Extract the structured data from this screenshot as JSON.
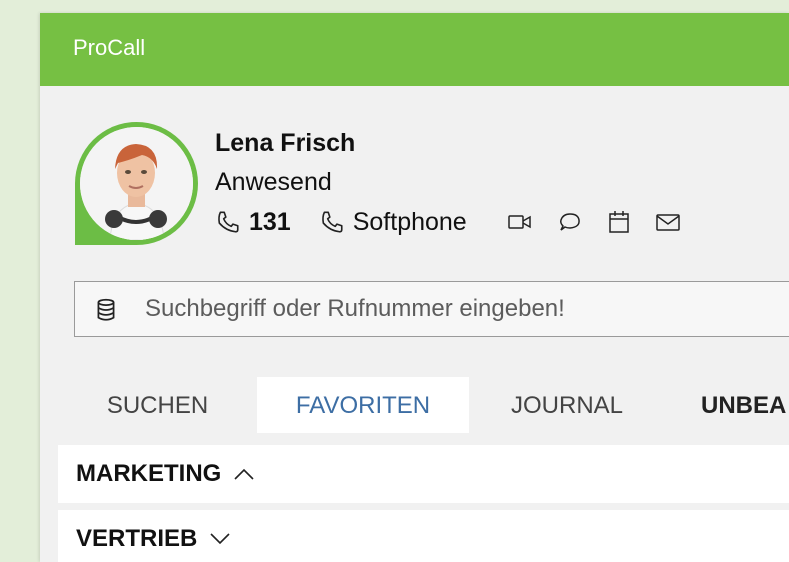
{
  "app": {
    "title": "ProCall"
  },
  "user": {
    "name": "Lena Frisch",
    "status": "Anwesend",
    "extension": "131",
    "device": "Softphone",
    "actions": [
      "video-icon",
      "chat-icon",
      "calendar-icon",
      "mail-icon"
    ]
  },
  "search": {
    "placeholder": "Suchbegriff oder Rufnummer eingeben!"
  },
  "tabs": [
    {
      "label": "SUCHEN",
      "active": false
    },
    {
      "label": "FAVORITEN",
      "active": true
    },
    {
      "label": "JOURNAL",
      "active": false
    },
    {
      "label": "UNBEA",
      "active": false
    }
  ],
  "groups": [
    {
      "label": "MARKETING",
      "expanded": true
    },
    {
      "label": "VERTRIEB",
      "expanded": false
    }
  ],
  "colors": {
    "titlebar": "#76c043",
    "presence": "#6cbd45",
    "active_tab": "#3d6ea4"
  }
}
